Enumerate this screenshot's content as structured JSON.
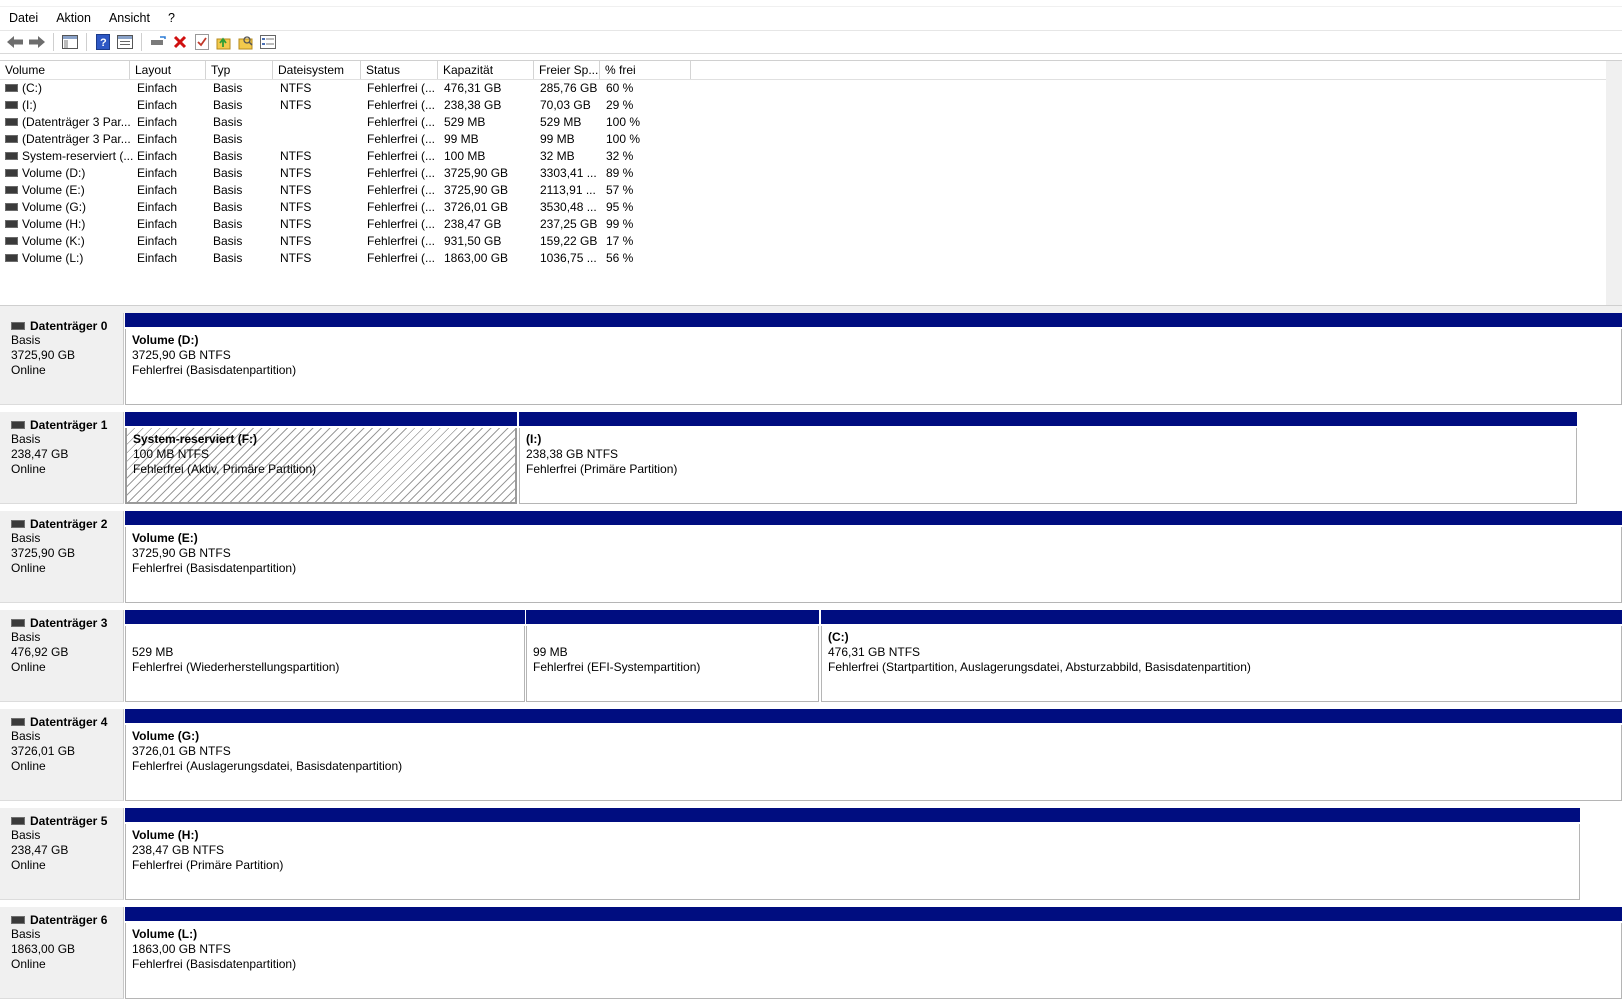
{
  "menu": [
    "Datei",
    "Aktion",
    "Ansicht",
    "?"
  ],
  "toolbar": {
    "buttons": [
      "back-arrow-icon",
      "forward-arrow-icon",
      "console-tree-icon",
      "help-icon",
      "properties-icon",
      "connect-icon",
      "delete-icon",
      "check-icon",
      "folder-up-icon",
      "folder-search-icon",
      "list-view-icon"
    ]
  },
  "volume_table": {
    "columns": [
      "Volume",
      "Layout",
      "Typ",
      "Dateisystem",
      "Status",
      "Kapazität",
      "Freier Sp...",
      "% frei"
    ],
    "rows": [
      [
        "(C:)",
        "Einfach",
        "Basis",
        "NTFS",
        "Fehlerfrei (...",
        "476,31 GB",
        "285,76 GB",
        "60 %"
      ],
      [
        "(I:)",
        "Einfach",
        "Basis",
        "NTFS",
        "Fehlerfrei (...",
        "238,38 GB",
        "70,03 GB",
        "29 %"
      ],
      [
        "(Datenträger 3 Par...",
        "Einfach",
        "Basis",
        "",
        "Fehlerfrei (...",
        "529 MB",
        "529 MB",
        "100 %"
      ],
      [
        "(Datenträger 3 Par...",
        "Einfach",
        "Basis",
        "",
        "Fehlerfrei (...",
        "99 MB",
        "99 MB",
        "100 %"
      ],
      [
        "System-reserviert (...",
        "Einfach",
        "Basis",
        "NTFS",
        "Fehlerfrei (...",
        "100 MB",
        "32 MB",
        "32 %"
      ],
      [
        "Volume (D:)",
        "Einfach",
        "Basis",
        "NTFS",
        "Fehlerfrei (...",
        "3725,90 GB",
        "3303,41 ...",
        "89 %"
      ],
      [
        "Volume (E:)",
        "Einfach",
        "Basis",
        "NTFS",
        "Fehlerfrei (...",
        "3725,90 GB",
        "2113,91 ...",
        "57 %"
      ],
      [
        "Volume (G:)",
        "Einfach",
        "Basis",
        "NTFS",
        "Fehlerfrei (...",
        "3726,01 GB",
        "3530,48 ...",
        "95 %"
      ],
      [
        "Volume (H:)",
        "Einfach",
        "Basis",
        "NTFS",
        "Fehlerfrei (...",
        "238,47 GB",
        "237,25 GB",
        "99 %"
      ],
      [
        "Volume (K:)",
        "Einfach",
        "Basis",
        "NTFS",
        "Fehlerfrei (...",
        "931,50 GB",
        "159,22 GB",
        "17 %"
      ],
      [
        "Volume (L:)",
        "Einfach",
        "Basis",
        "NTFS",
        "Fehlerfrei (...",
        "1863,00 GB",
        "1036,75 ...",
        "56 %"
      ]
    ]
  },
  "disks": [
    {
      "name": "Datenträger 0",
      "type": "Basis",
      "size": "3725,90 GB",
      "state": "Online",
      "partitions": [
        {
          "title": "Volume  (D:)",
          "size_fs": "3725,90 GB NTFS",
          "status": "Fehlerfrei (Basisdatenpartition)",
          "hatched": false
        }
      ]
    },
    {
      "name": "Datenträger 1",
      "type": "Basis",
      "size": "238,47 GB",
      "state": "Online",
      "partitions": [
        {
          "title": "System-reserviert  (F:)",
          "size_fs": "100 MB NTFS",
          "status": "Fehlerfrei (Aktiv, Primäre Partition)",
          "hatched": true
        },
        {
          "title": "(I:)",
          "size_fs": "238,38 GB NTFS",
          "status": "Fehlerfrei (Primäre Partition)",
          "hatched": false
        }
      ]
    },
    {
      "name": "Datenträger 2",
      "type": "Basis",
      "size": "3725,90 GB",
      "state": "Online",
      "partitions": [
        {
          "title": "Volume  (E:)",
          "size_fs": "3725,90 GB NTFS",
          "status": "Fehlerfrei (Basisdatenpartition)",
          "hatched": false
        }
      ]
    },
    {
      "name": "Datenträger 3",
      "type": "Basis",
      "size": "476,92 GB",
      "state": "Online",
      "partitions": [
        {
          "title": "",
          "size_fs": "529 MB",
          "status": "Fehlerfrei (Wiederherstellungspartition)",
          "hatched": false
        },
        {
          "title": "",
          "size_fs": "99 MB",
          "status": "Fehlerfrei (EFI-Systempartition)",
          "hatched": false
        },
        {
          "title": "(C:)",
          "size_fs": "476,31 GB NTFS",
          "status": "Fehlerfrei (Startpartition, Auslagerungsdatei, Absturzabbild, Basisdatenpartition)",
          "hatched": false
        }
      ]
    },
    {
      "name": "Datenträger 4",
      "type": "Basis",
      "size": "3726,01 GB",
      "state": "Online",
      "partitions": [
        {
          "title": "Volume  (G:)",
          "size_fs": "3726,01 GB NTFS",
          "status": "Fehlerfrei (Auslagerungsdatei, Basisdatenpartition)",
          "hatched": false
        }
      ]
    },
    {
      "name": "Datenträger 5",
      "type": "Basis",
      "size": "238,47 GB",
      "state": "Online",
      "partitions": [
        {
          "title": "Volume  (H:)",
          "size_fs": "238,47 GB NTFS",
          "status": "Fehlerfrei (Primäre Partition)",
          "hatched": false
        }
      ]
    },
    {
      "name": "Datenträger 6",
      "type": "Basis",
      "size": "1863,00 GB",
      "state": "Online",
      "partitions": [
        {
          "title": "Volume  (L:)",
          "size_fs": "1863,00 GB NTFS",
          "status": "Fehlerfrei (Basisdatenpartition)",
          "hatched": false
        }
      ]
    }
  ],
  "colors": {
    "partition_bar": "#000d80",
    "label_bg": "#f0f0f0"
  }
}
